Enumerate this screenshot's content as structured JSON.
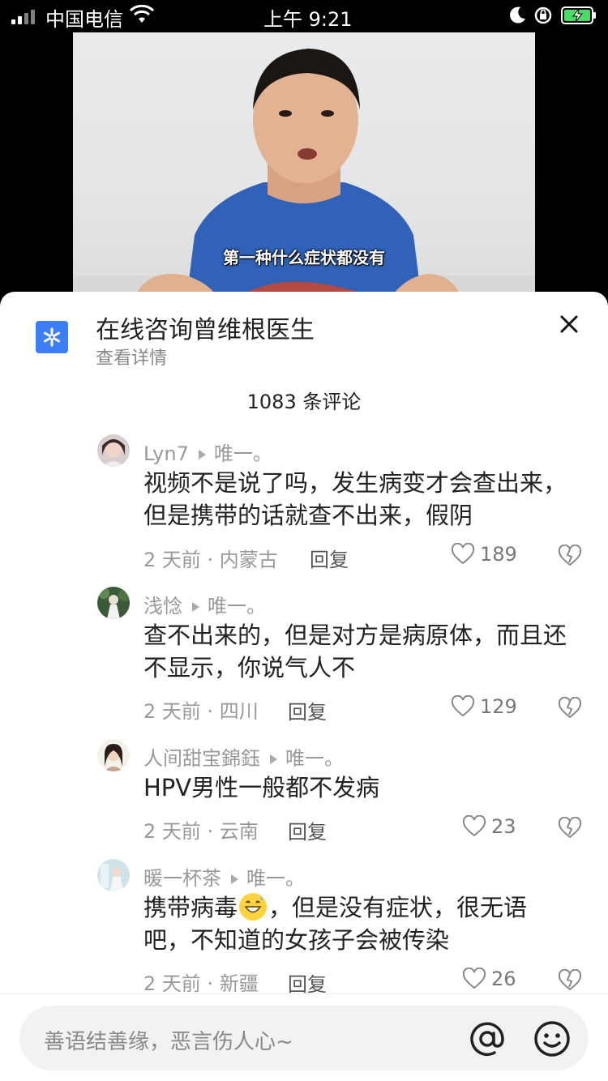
{
  "status_bar": {
    "carrier": "中国电信",
    "time": "上午 9:21"
  },
  "video": {
    "caption": "第一种什么症状都没有"
  },
  "consult": {
    "title": "在线咨询曾维根医生",
    "subtitle": "查看详情"
  },
  "comments_header": {
    "count_label": "1083 条评论"
  },
  "comments": [
    {
      "name": "Lyn7",
      "reply_to": "唯一。",
      "text": "视频不是说了吗，发生病变才会查出来，但是携带的话就查不出来，假阴",
      "meta": "2 天前 · 内蒙古",
      "reply_label": "回复",
      "likes": "189"
    },
    {
      "name": "浅惗",
      "reply_to": "唯一。",
      "text": "查不出来的，但是对方是病原体，而且还不显示，你说气人不",
      "meta": "2 天前 · 四川",
      "reply_label": "回复",
      "likes": "129"
    },
    {
      "name": "人间甜宝錦鈺",
      "reply_to": "唯一。",
      "text": "HPV男性一般都不发病",
      "meta": "2 天前 · 云南",
      "reply_label": "回复",
      "likes": "23"
    },
    {
      "name": "暖一杯茶",
      "reply_to": "唯一。",
      "text_before": "携带病毒",
      "text_after": "，但是没有症状，很无语吧，不知道的女孩子会被传染",
      "meta": "2 天前 · 新疆",
      "reply_label": "回复",
      "likes": "26"
    }
  ],
  "input": {
    "placeholder": "善语结善缘，恶言伤人心~"
  },
  "icons": {
    "consult": "medical-star-icon",
    "close": "close-icon",
    "like": "heart-outline-icon",
    "dislike": "broken-heart-icon",
    "mention": "at-icon",
    "emoji": "smiley-icon"
  },
  "colors": {
    "accent_blue": "#3d7df7",
    "text_primary": "#222222",
    "text_secondary": "#999999"
  }
}
